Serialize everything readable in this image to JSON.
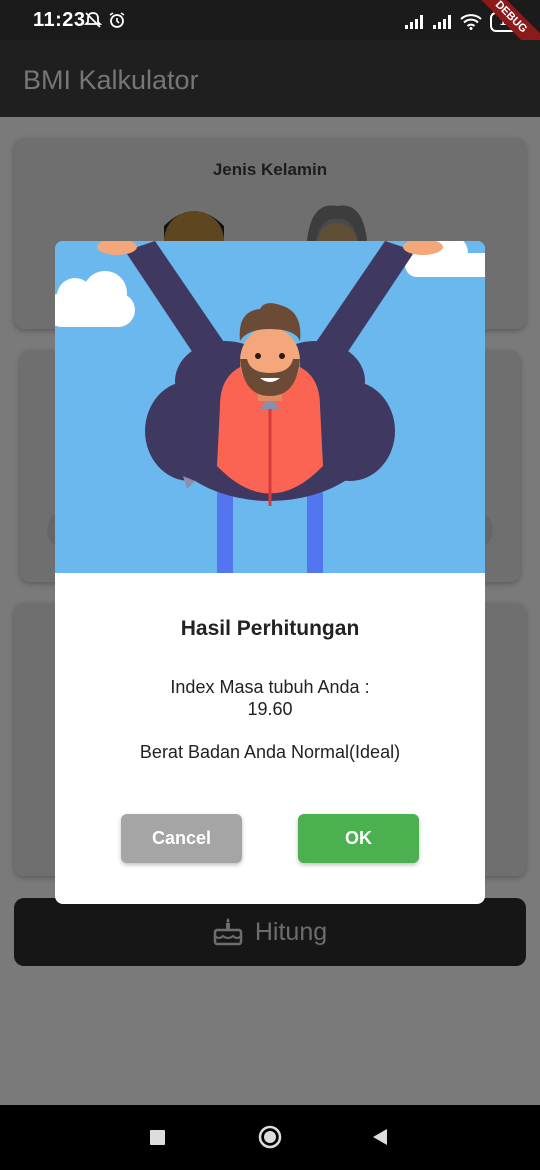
{
  "status_bar": {
    "time": "11:23",
    "battery": "12",
    "debug_banner": "DEBUG"
  },
  "app_bar": {
    "title": "BMI Kalkulator"
  },
  "background": {
    "gender_card_title": "Jenis Kelamin",
    "calculate_button_label": "Hitung"
  },
  "dialog": {
    "title": "Hasil Perhitungan",
    "index_label": "Index Masa tubuh Anda :",
    "index_value": "19.60",
    "result_text": "Berat Badan Anda Normal(Ideal)",
    "cancel_label": "Cancel",
    "ok_label": "OK"
  },
  "colors": {
    "ok_button": "#4caf50",
    "cancel_button": "#a5a5a5",
    "sky": "#6bb8ef",
    "jacket": "#3f3961",
    "shirt": "#fb6453"
  },
  "icons": [
    "mute-icon",
    "alarm-icon",
    "signal-icon",
    "wifi-icon",
    "battery-icon",
    "cake-icon",
    "recents-icon",
    "home-icon",
    "back-icon"
  ]
}
